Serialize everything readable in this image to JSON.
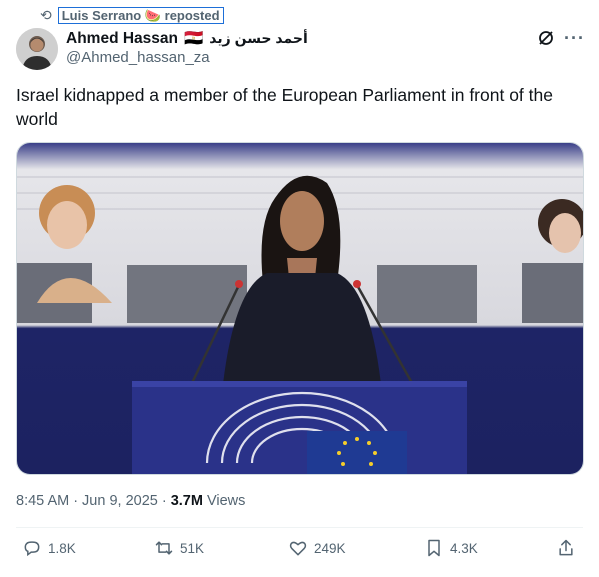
{
  "repost": {
    "reposter": "Luis Serrano",
    "watermelon": "🍉",
    "label": "reposted"
  },
  "author": {
    "name": "Ahmed Hassan",
    "flag": "🇪🇬",
    "arabic_name": "أحمد حسن زيد",
    "handle": "@Ahmed_hassan_za"
  },
  "tweet": {
    "text": "Israel kidnapped a member of the European Parliament in front of the world"
  },
  "meta": {
    "time": "8:45 AM",
    "date": "Jun 9, 2025",
    "views_count": "3.7M",
    "views_label": "Views"
  },
  "actions": {
    "replies": "1.8K",
    "reposts": "51K",
    "likes": "249K",
    "bookmarks": "4.3K"
  },
  "colors": {
    "text": "#0f1419",
    "muted": "#536471",
    "divider": "#eff3f4",
    "eu_blue": "#1f3a93",
    "eu_star": "#f5cd2a"
  }
}
